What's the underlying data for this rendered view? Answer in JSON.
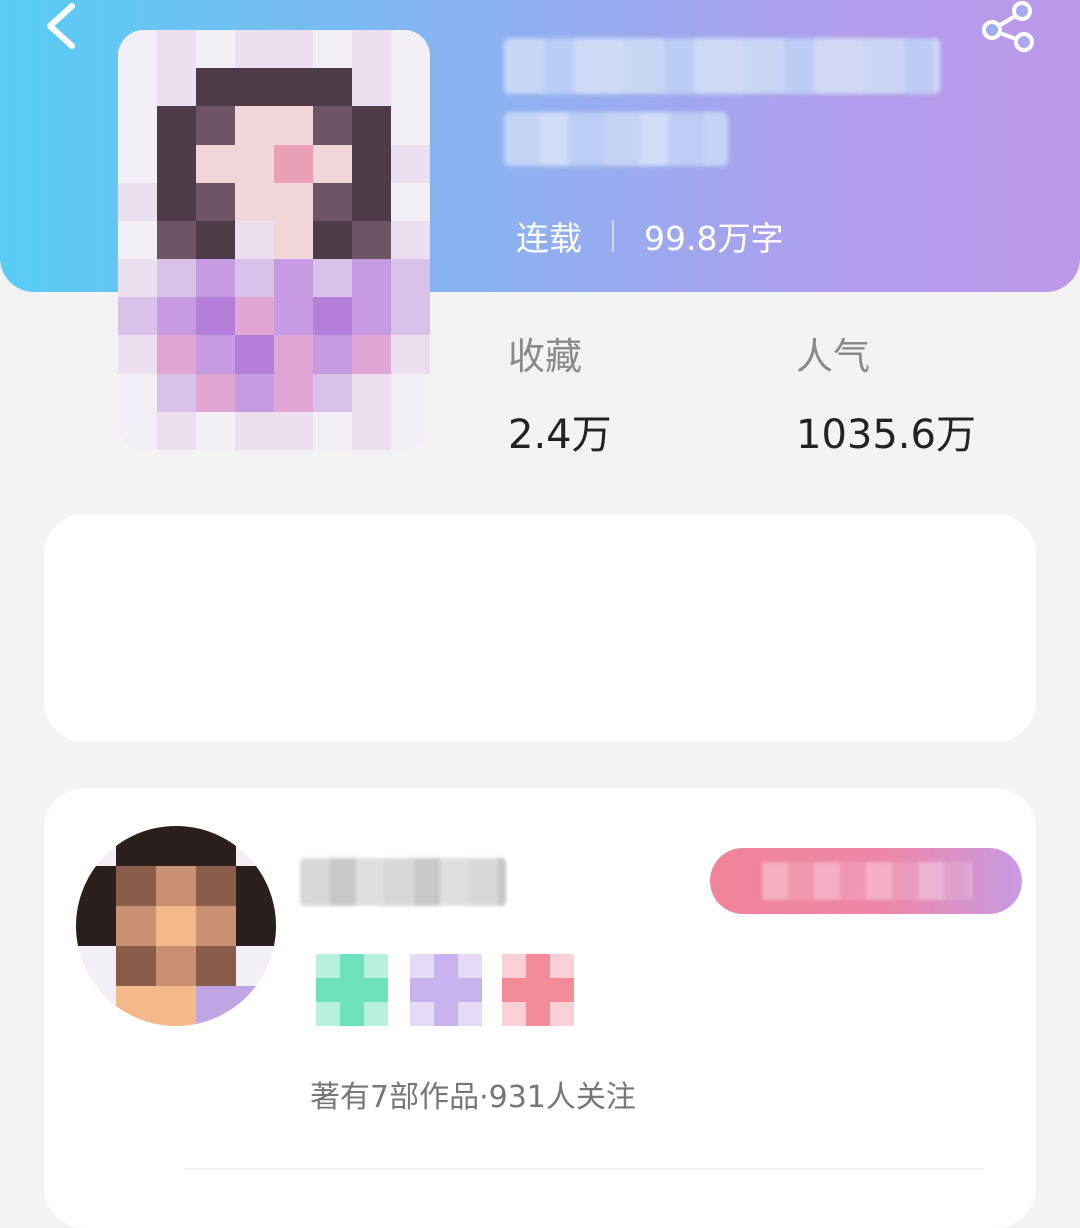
{
  "header": {
    "back_icon": "chevron-left-icon",
    "share_icon": "share-icon",
    "colors": {
      "gradient_start": "#57cdf5",
      "gradient_end": "#bb98ea"
    }
  },
  "book": {
    "status": "连载",
    "word_count": "99.8万字"
  },
  "stats": [
    {
      "label": "收藏",
      "value": "2.4万"
    },
    {
      "label": "人气",
      "value": "1035.6万"
    }
  ],
  "author": {
    "stats_text": "著有7部作品·931人关注"
  }
}
